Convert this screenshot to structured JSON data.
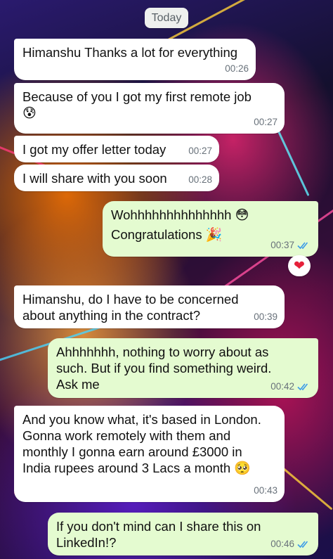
{
  "day_label": "Today",
  "colors": {
    "incoming": "#ffffff",
    "outgoing": "#e4fbd0",
    "read_ticks": "#3b9be8"
  },
  "messages": [
    {
      "dir": "in",
      "text": "Himanshu Thanks a lot for everything",
      "time": "00:26"
    },
    {
      "dir": "in",
      "text": "Because of you I got my first remote job",
      "emoji": "😰",
      "time": "00:27"
    },
    {
      "dir": "in",
      "text": "I got my offer letter today",
      "time": "00:27"
    },
    {
      "dir": "in",
      "text": "I will share with you soon",
      "time": "00:28"
    },
    {
      "dir": "out",
      "line1": "Wohhhhhhhhhhhhhh",
      "emoji1": "😳",
      "line2": "Congratulations",
      "emoji2": "🎉",
      "time": "00:37",
      "status": "read",
      "reaction": "❤"
    },
    {
      "dir": "in",
      "text": "Himanshu, do I have to be concerned\nabout anything in the contract?",
      "time": "00:39"
    },
    {
      "dir": "out",
      "text": "Ahhhhhhh, nothing to worry about as\nsuch. But if you find something weird.\nAsk me",
      "time": "00:42",
      "status": "read"
    },
    {
      "dir": "in",
      "text": "And you know what, it's based in London.\nGonna work remotely with them and\nmonthly I gonna earn around £3000 in\nIndia rupees around 3 Lacs a month",
      "emoji": "🥺",
      "time": "00:43"
    },
    {
      "dir": "out",
      "text": "If you don't mind can I share this on\nLinkedIn!?",
      "time": "00:46",
      "status": "read"
    }
  ]
}
